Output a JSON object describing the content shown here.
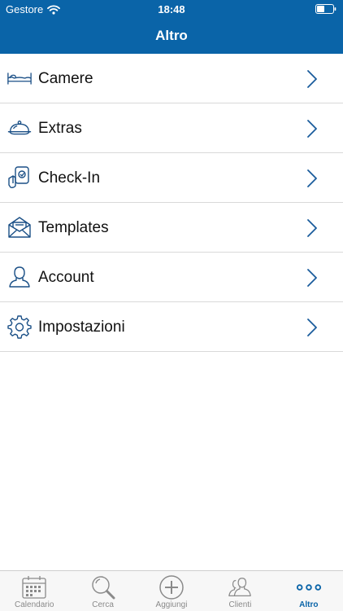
{
  "status_bar": {
    "carrier": "Gestore",
    "time": "18:48"
  },
  "header": {
    "title": "Altro"
  },
  "menu": {
    "items": [
      {
        "label": "Camere",
        "icon": "bed-icon"
      },
      {
        "label": "Extras",
        "icon": "cloche-icon"
      },
      {
        "label": "Check-In",
        "icon": "phone-hand-icon"
      },
      {
        "label": "Templates",
        "icon": "envelope-icon"
      },
      {
        "label": "Account",
        "icon": "user-icon"
      },
      {
        "label": "Impostazioni",
        "icon": "gear-icon"
      }
    ]
  },
  "tabbar": {
    "tabs": [
      {
        "label": "Calendario",
        "icon": "calendar-icon",
        "active": false
      },
      {
        "label": "Cerca",
        "icon": "search-icon",
        "active": false
      },
      {
        "label": "Aggiungi",
        "icon": "plus-circle-icon",
        "active": false
      },
      {
        "label": "Clienti",
        "icon": "people-icon",
        "active": false
      },
      {
        "label": "Altro",
        "icon": "more-dots-icon",
        "active": true
      }
    ]
  },
  "colors": {
    "header_bg": "#0a64a8",
    "icon_stroke": "#1a4f86",
    "chevron": "#1a5c9c",
    "tab_inactive": "#8a8a8a",
    "tab_active": "#0a64a8"
  }
}
